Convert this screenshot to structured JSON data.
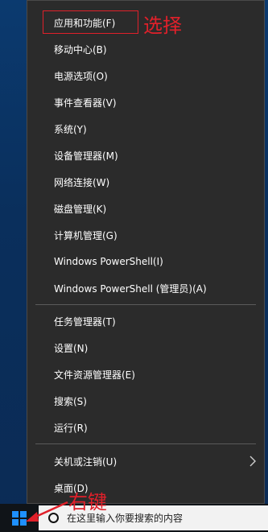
{
  "menu": {
    "items": [
      {
        "label": "应用和功能(F)"
      },
      {
        "label": "移动中心(B)"
      },
      {
        "label": "电源选项(O)"
      },
      {
        "label": "事件查看器(V)"
      },
      {
        "label": "系统(Y)"
      },
      {
        "label": "设备管理器(M)"
      },
      {
        "label": "网络连接(W)"
      },
      {
        "label": "磁盘管理(K)"
      },
      {
        "label": "计算机管理(G)"
      },
      {
        "label": "Windows PowerShell(I)"
      },
      {
        "label": "Windows PowerShell (管理员)(A)"
      },
      {
        "label": "任务管理器(T)"
      },
      {
        "label": "设置(N)"
      },
      {
        "label": "文件资源管理器(E)"
      },
      {
        "label": "搜索(S)"
      },
      {
        "label": "运行(R)"
      },
      {
        "label": "关机或注销(U)"
      },
      {
        "label": "桌面(D)"
      }
    ]
  },
  "annotations": {
    "select": "选择",
    "right_click": "右键"
  },
  "taskbar": {
    "search_placeholder": "在这里输入你要搜索的内容"
  },
  "colors": {
    "menu_bg": "#2b2b2b",
    "annotation": "#e0202a",
    "taskbar": "#101418",
    "start_icon": "#1e90ff"
  }
}
